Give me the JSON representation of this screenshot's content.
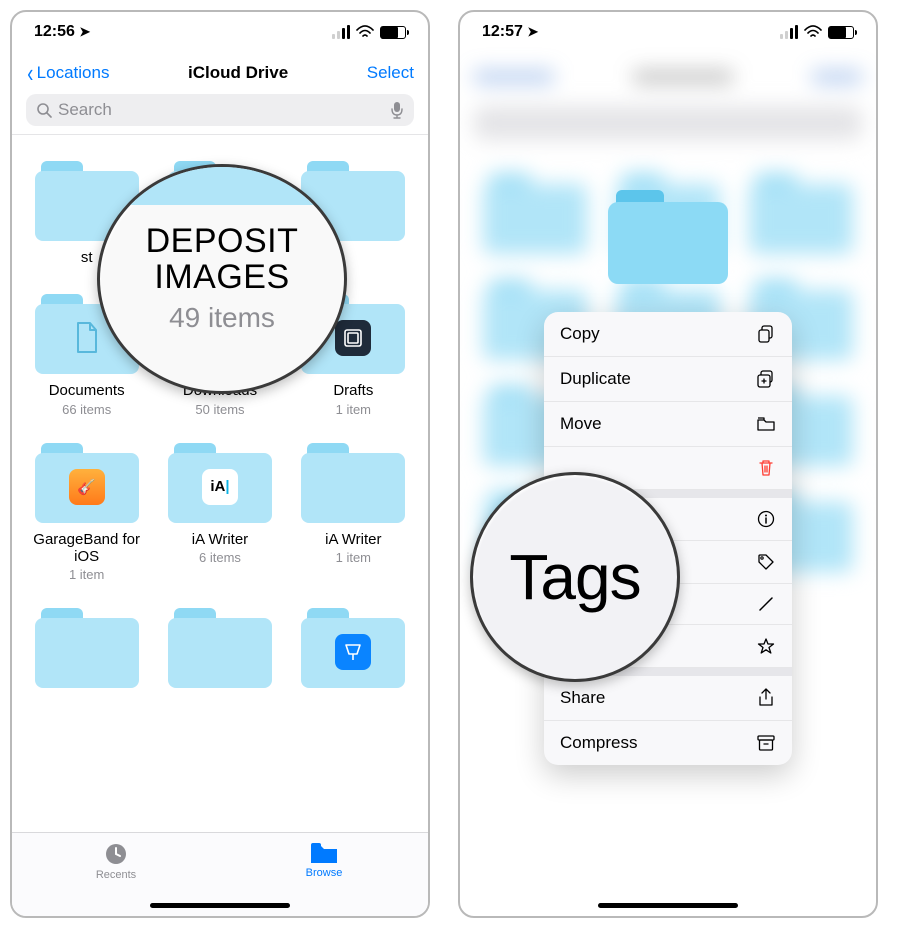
{
  "screens": {
    "left": {
      "status": {
        "time": "12:56"
      },
      "nav": {
        "back": "Locations",
        "title": "iCloud Drive",
        "select": "Select"
      },
      "search_placeholder": "Search",
      "callout": {
        "title_l1": "DEPOSIT",
        "title_l2": "IMAGES",
        "sub": "49 items"
      },
      "folders": [
        {
          "name": "st",
          "sub": "",
          "badge": "none"
        },
        {
          "name": "",
          "sub": "",
          "badge": "none"
        },
        {
          "name": "",
          "sub": "",
          "badge": "none"
        },
        {
          "name": "Documents",
          "sub": "66 items",
          "badge": "doc"
        },
        {
          "name": "Downloads",
          "sub": "50 items",
          "badge": "down"
        },
        {
          "name": "Drafts",
          "sub": "1 item",
          "badge": "drafts"
        },
        {
          "name": "GarageBand for iOS",
          "sub": "1 item",
          "badge": "gb"
        },
        {
          "name": "iA Writer",
          "sub": "6 items",
          "badge": "ia"
        },
        {
          "name": "iA Writer",
          "sub": "1 item",
          "badge": "none"
        },
        {
          "name": "",
          "sub": "",
          "badge": "none"
        },
        {
          "name": "",
          "sub": "",
          "badge": "none"
        },
        {
          "name": "",
          "sub": "",
          "badge": "keynote"
        }
      ],
      "tabs": {
        "recents": "Recents",
        "browse": "Browse"
      }
    },
    "right": {
      "status": {
        "time": "12:57"
      },
      "callout": "Tags",
      "menu": {
        "copy": "Copy",
        "duplicate": "Duplicate",
        "move": "Move",
        "delete": "",
        "info": "",
        "tags": "",
        "rename": "",
        "favorite": "",
        "share": "Share",
        "compress": "Compress"
      }
    }
  }
}
